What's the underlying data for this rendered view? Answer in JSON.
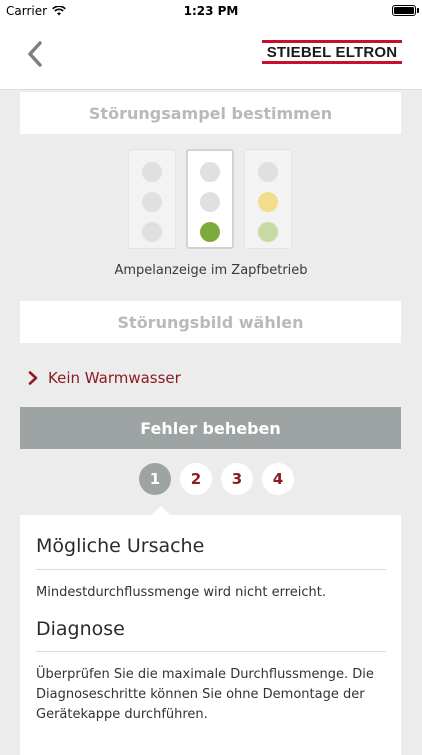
{
  "status_bar": {
    "carrier": "Carrier",
    "time": "1:23 PM"
  },
  "nav": {
    "logo_text": "STIEBEL ELTRON",
    "back_icon": "chevron-left-icon",
    "colors": {
      "logo_red": "#c8102e",
      "back_arrow": "#7a8082"
    }
  },
  "section_traffic": {
    "header": "Störungsampel bestimmen",
    "lights": [
      {
        "dots": [
          "#e0e0e0",
          "#e0e0e0",
          "#e0e0e0"
        ],
        "selected": false
      },
      {
        "dots": [
          "#e0e0e0",
          "#e0e0e0",
          "#7bab3a"
        ],
        "selected": true
      },
      {
        "dots": [
          "#e0e0e0",
          "#f3dc8c",
          "#c9d9a3"
        ],
        "selected": false
      }
    ],
    "caption": "Ampelanzeige im Zapfbetrieb"
  },
  "section_fault": {
    "header": "Störungsbild wählen",
    "selected_fault": "Kein Warmwasser"
  },
  "fix": {
    "button_label": "Fehler beheben",
    "steps": [
      "1",
      "2",
      "3",
      "4"
    ],
    "active_step": "1"
  },
  "card": {
    "cause_heading": "Mögliche Ursache",
    "cause_text": "Mindestdurchflussmenge wird nicht erreicht.",
    "diagnosis_heading": "Diagnose",
    "diagnosis_text": "Überprüfen Sie die maximale Durchflussmenge. Die Diagnoseschritte können Sie ohne Demontage der Gerätekappe durchführen."
  },
  "colors": {
    "accent": "#8b1c24",
    "button_gray": "#9ea3a3",
    "background": "#ececec"
  }
}
